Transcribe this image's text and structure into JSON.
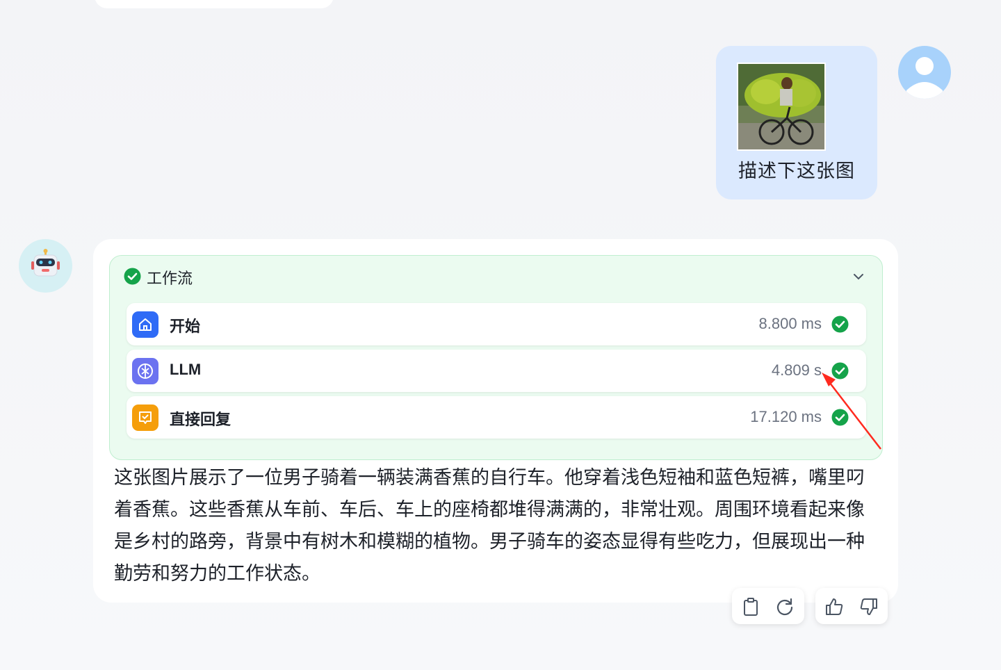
{
  "user_message": {
    "text": "描述下这张图",
    "image_icon": "uploaded-photo-man-on-bicycle-with-bananas",
    "bubble_color": "#dbe9fe"
  },
  "user_avatar": {
    "icon": "user-silhouette-icon",
    "color": "#c9e3fc"
  },
  "bot_avatar": {
    "icon": "robot-icon",
    "color": "#d6f0f4"
  },
  "workflow": {
    "title": "工作流",
    "status_icon": "check-circle-icon",
    "status_color": "#15a34a",
    "collapse_icon": "chevron-down-icon",
    "nodes": [
      {
        "label": "开始",
        "time": "8.800 ms",
        "icon": "home-icon",
        "icon_color": "#2f6bf6"
      },
      {
        "label": "LLM",
        "time": "4.809 s",
        "icon": "brain-icon",
        "icon_color": "#6b72f0"
      },
      {
        "label": "直接回复",
        "time": "17.120 ms",
        "icon": "reply-message-icon",
        "icon_color": "#f59e0b"
      }
    ]
  },
  "answer": {
    "text": "这张图片展示了一位男子骑着一辆装满香蕉的自行车。他穿着浅色短袖和蓝色短裤，嘴里叼着香蕉。这些香蕉从车前、车后、车上的座椅都堆得满满的，非常壮观。周围环境看起来像是乡村的路旁，背景中有树木和模糊的植物。男子骑车的姿态显得有些吃力，但展现出一种勤劳和努力的工作状态。"
  },
  "actions": {
    "copy_icon": "clipboard-icon",
    "regenerate_icon": "refresh-icon",
    "like_icon": "thumbs-up-icon",
    "dislike_icon": "thumbs-down-icon"
  },
  "annotation_color": "#ff2a1f"
}
